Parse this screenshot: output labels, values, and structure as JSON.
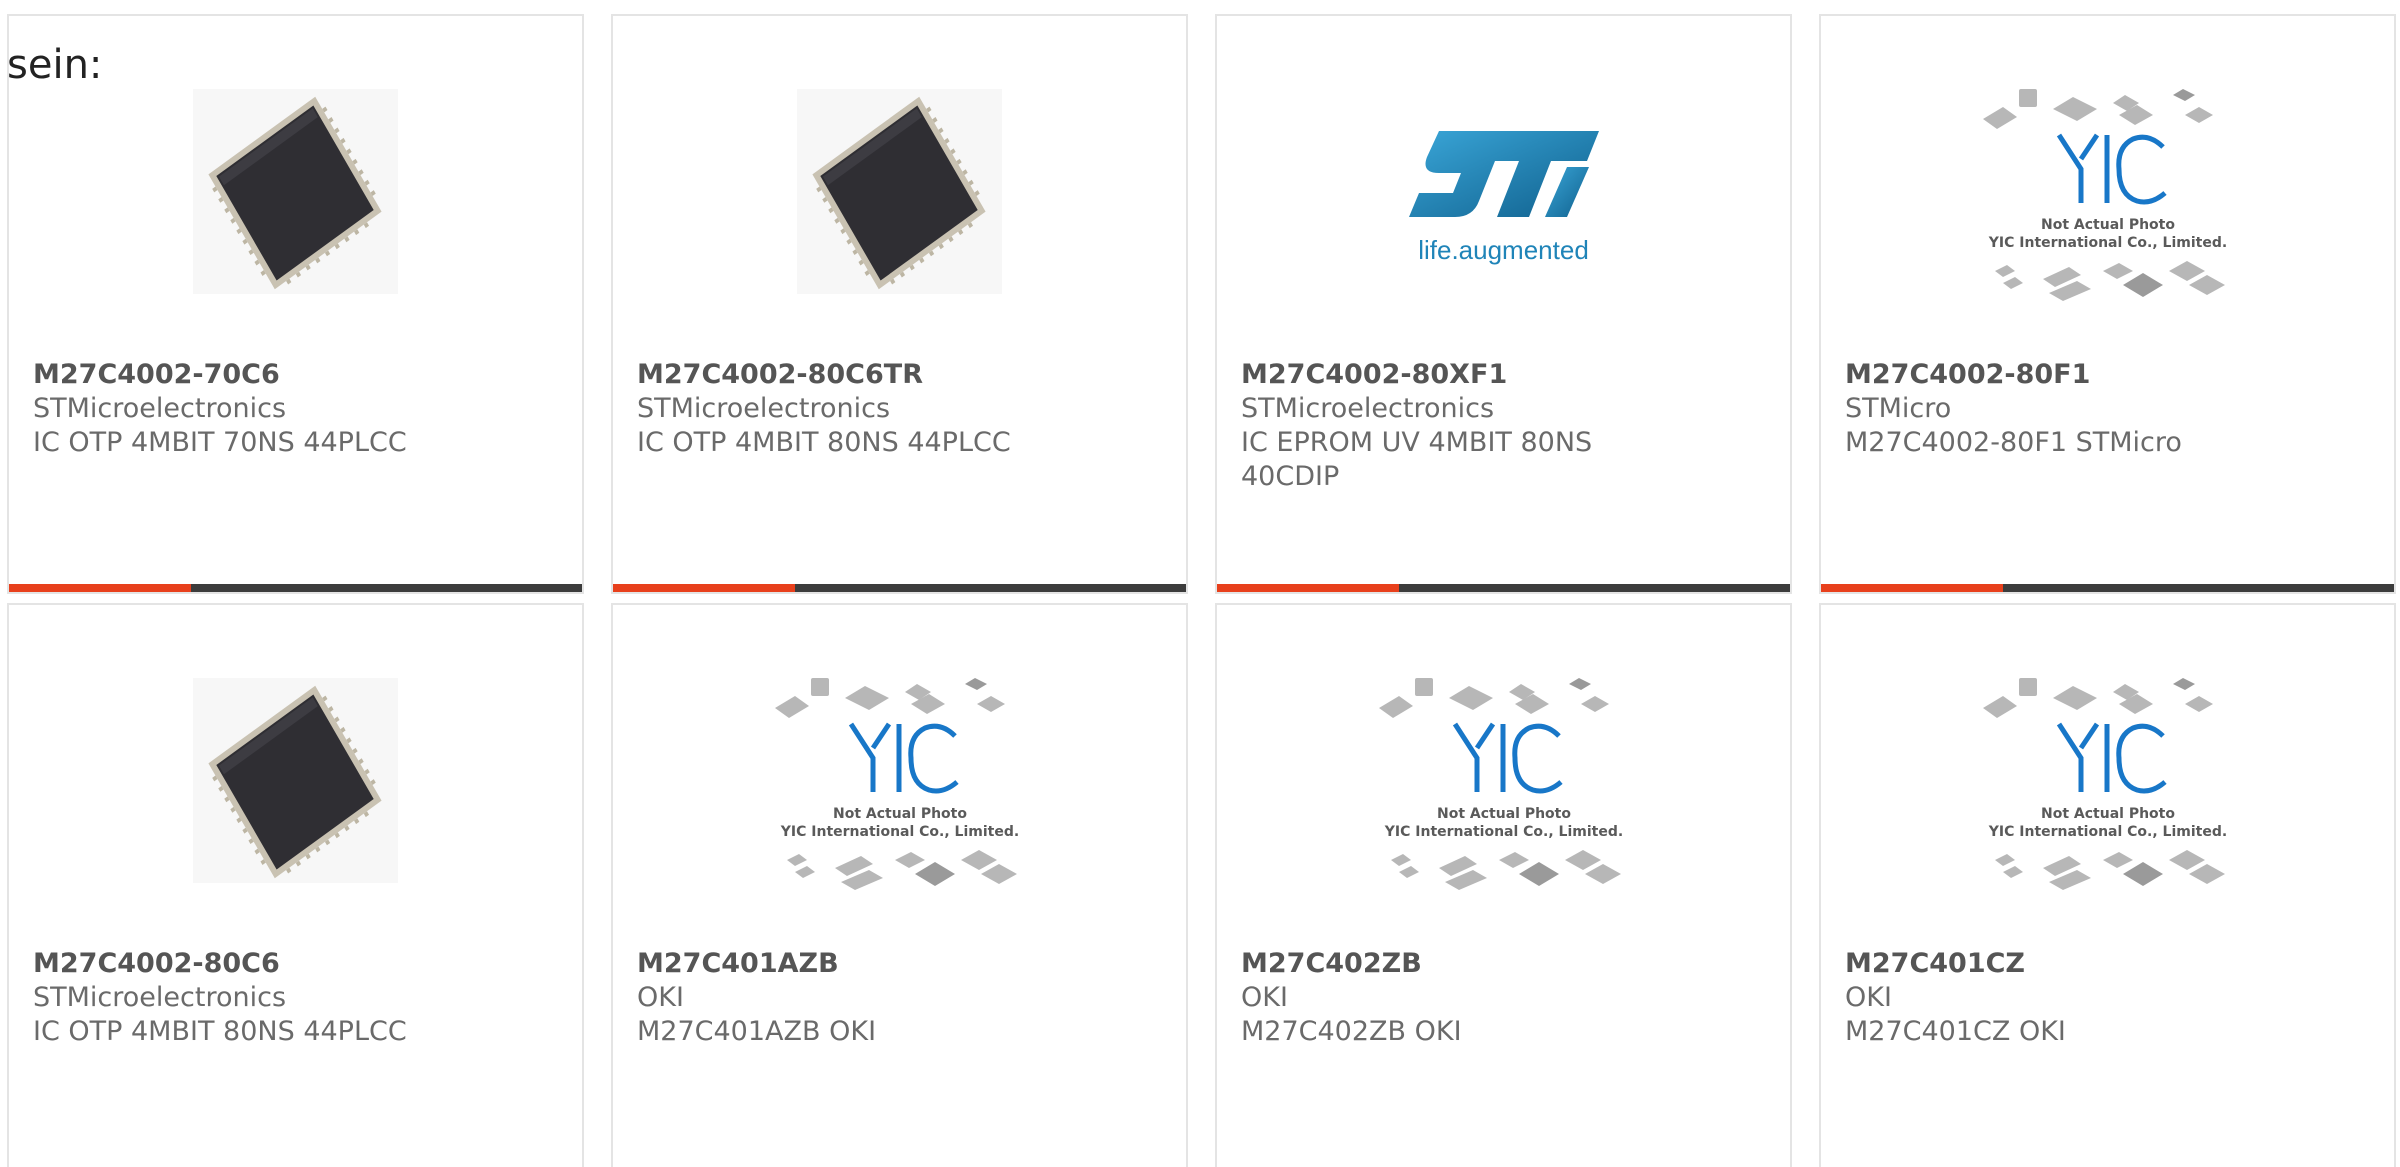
{
  "intro_text": "sein:",
  "colors": {
    "accent": "#e8401c",
    "bar": "#3c3c3c",
    "st_logo_blue": "#1f84b8",
    "yic_blue": "#1877c8"
  },
  "products": [
    {
      "part": "M27C4002-70C6",
      "maker": "STMicroelectronics",
      "desc": "IC OTP 4MBIT 70NS 44PLCC",
      "image": "plcc-chip"
    },
    {
      "part": "M27C4002-80C6TR",
      "maker": "STMicroelectronics",
      "desc": "IC OTP 4MBIT 80NS 44PLCC",
      "image": "plcc-chip"
    },
    {
      "part": "M27C4002-80XF1",
      "maker": "STMicroelectronics",
      "desc": "IC EPROM UV 4MBIT 80NS 40CDIP",
      "image": "st-logo"
    },
    {
      "part": "M27C4002-80F1",
      "maker": "STMicro",
      "desc": "M27C4002-80F1 STMicro",
      "image": "yic-placeholder"
    },
    {
      "part": "M27C4002-80C6",
      "maker": "STMicroelectronics",
      "desc": "IC OTP 4MBIT 80NS 44PLCC",
      "image": "plcc-chip"
    },
    {
      "part": "M27C401AZB",
      "maker": "OKI",
      "desc": "M27C401AZB OKI",
      "image": "yic-placeholder"
    },
    {
      "part": "M27C402ZB",
      "maker": "OKI",
      "desc": "M27C402ZB OKI",
      "image": "yic-placeholder"
    },
    {
      "part": "M27C401CZ",
      "maker": "OKI",
      "desc": "M27C401CZ OKI",
      "image": "yic-placeholder"
    }
  ],
  "st_logo": {
    "tagline": "life.augmented"
  },
  "yic_placeholder": {
    "line1": "Not Actual Photo",
    "line2": "YIC International Co., Limited."
  }
}
